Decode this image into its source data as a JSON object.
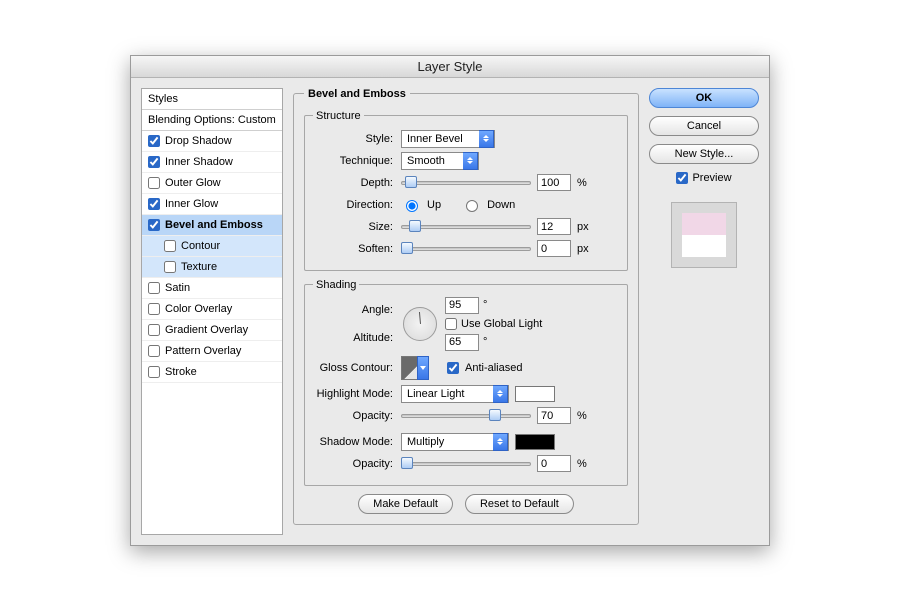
{
  "window": {
    "title": "Layer Style"
  },
  "sidebar": {
    "header": "Styles",
    "blending": "Blending Options: Custom",
    "items": [
      {
        "label": "Drop Shadow",
        "checked": true,
        "selected": false,
        "sub": false
      },
      {
        "label": "Inner Shadow",
        "checked": true,
        "selected": false,
        "sub": false
      },
      {
        "label": "Outer Glow",
        "checked": false,
        "selected": false,
        "sub": false
      },
      {
        "label": "Inner Glow",
        "checked": true,
        "selected": false,
        "sub": false
      },
      {
        "label": "Bevel and Emboss",
        "checked": true,
        "selected": true,
        "sub": false
      },
      {
        "label": "Contour",
        "checked": false,
        "selected": true,
        "sub": true
      },
      {
        "label": "Texture",
        "checked": false,
        "selected": true,
        "sub": true
      },
      {
        "label": "Satin",
        "checked": false,
        "selected": false,
        "sub": false
      },
      {
        "label": "Color Overlay",
        "checked": false,
        "selected": false,
        "sub": false
      },
      {
        "label": "Gradient Overlay",
        "checked": false,
        "selected": false,
        "sub": false
      },
      {
        "label": "Pattern Overlay",
        "checked": false,
        "selected": false,
        "sub": false
      },
      {
        "label": "Stroke",
        "checked": false,
        "selected": false,
        "sub": false
      }
    ]
  },
  "panel": {
    "title": "Bevel and Emboss",
    "structure": {
      "legend": "Structure",
      "style_label": "Style:",
      "style_value": "Inner Bevel",
      "technique_label": "Technique:",
      "technique_value": "Smooth",
      "depth_label": "Depth:",
      "depth_value": "100",
      "depth_unit": "%",
      "direction_label": "Direction:",
      "up_label": "Up",
      "down_label": "Down",
      "size_label": "Size:",
      "size_value": "12",
      "size_unit": "px",
      "soften_label": "Soften:",
      "soften_value": "0",
      "soften_unit": "px"
    },
    "shading": {
      "legend": "Shading",
      "angle_label": "Angle:",
      "angle_value": "95",
      "angle_unit": "°",
      "use_global_label": "Use Global Light",
      "altitude_label": "Altitude:",
      "altitude_value": "65",
      "altitude_unit": "°",
      "gloss_label": "Gloss Contour:",
      "anti_label": "Anti-aliased",
      "highlight_label": "Highlight Mode:",
      "highlight_value": "Linear Light",
      "highlight_swatch": "#ffffff",
      "h_opacity_label": "Opacity:",
      "h_opacity_value": "70",
      "h_opacity_unit": "%",
      "shadow_label": "Shadow Mode:",
      "shadow_value": "Multiply",
      "shadow_swatch": "#000000",
      "s_opacity_label": "Opacity:",
      "s_opacity_value": "0",
      "s_opacity_unit": "%"
    },
    "make_default": "Make Default",
    "reset_default": "Reset to Default"
  },
  "buttons": {
    "ok": "OK",
    "cancel": "Cancel",
    "new_style": "New Style...",
    "preview": "Preview"
  }
}
